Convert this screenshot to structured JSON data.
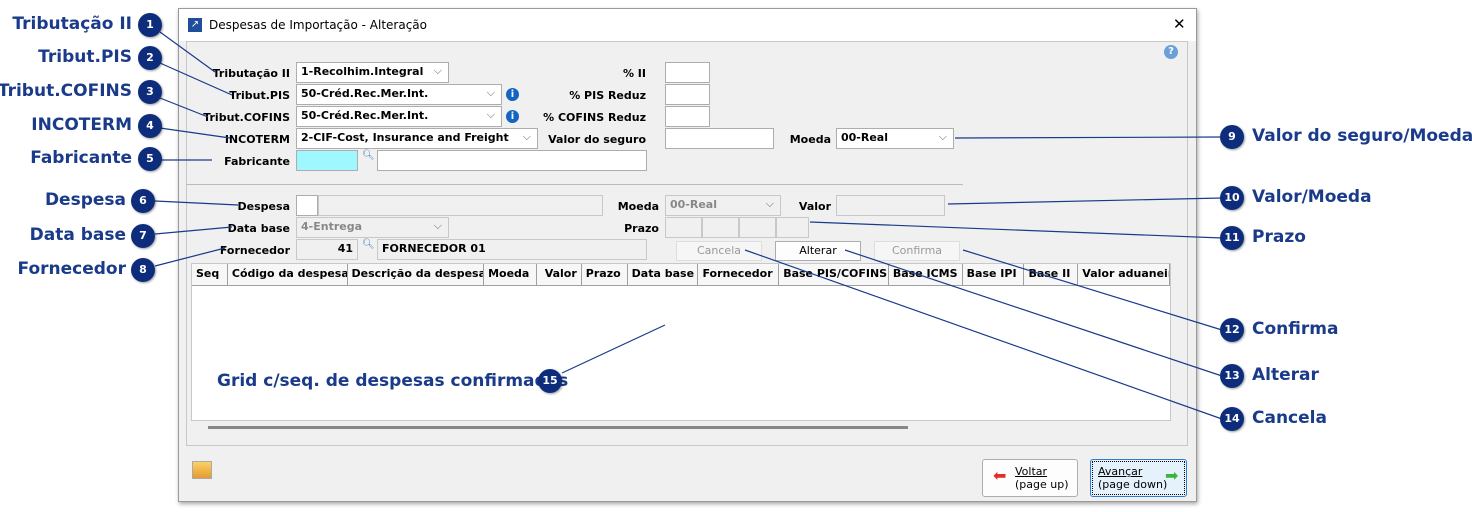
{
  "window": {
    "title": "Despesas de Importação - Alteração",
    "close": "✕",
    "help": "?"
  },
  "form": {
    "tributacao_ii": {
      "label": "Tributação II",
      "value": "1-Recolhim.Integral"
    },
    "tribut_pis": {
      "label": "Tribut.PIS",
      "value": "50-Créd.Rec.Mer.Int."
    },
    "tribut_cofins": {
      "label": "Tribut.COFINS",
      "value": "50-Créd.Rec.Mer.Int."
    },
    "incoterm": {
      "label": "INCOTERM",
      "value": "2-CIF-Cost, Insurance and Freight"
    },
    "fabricante": {
      "label": "Fabricante",
      "code": "",
      "name": ""
    },
    "pct_ii": {
      "label": "% II",
      "value": ""
    },
    "pct_pis": {
      "label": "% PIS Reduz",
      "value": ""
    },
    "pct_cofins": {
      "label": "% COFINS Reduz",
      "value": ""
    },
    "valor_seguro": {
      "label": "Valor do seguro",
      "value": ""
    },
    "moeda": {
      "label": "Moeda",
      "value": "00-Real"
    }
  },
  "despesa": {
    "despesa": {
      "label": "Despesa",
      "code": "",
      "desc": ""
    },
    "moeda": {
      "label": "Moeda",
      "value": "00-Real"
    },
    "valor": {
      "label": "Valor",
      "value": ""
    },
    "data_base": {
      "label": "Data base",
      "value": "4-Entrega"
    },
    "prazo": {
      "label": "Prazo"
    },
    "fornecedor": {
      "label": "Fornecedor",
      "code": "41",
      "name": "FORNECEDOR 01"
    },
    "cancela": "Cancela",
    "alterar": "Alterar",
    "confirma": "Confirma"
  },
  "grid": {
    "columns": [
      "Seq",
      "Código da despesa",
      "Descrição da despesa",
      "Moeda",
      "Valor",
      "Prazo",
      "Data base",
      "Fornecedor",
      "Base PIS/COFINS",
      "Base ICMS",
      "Base IPI",
      "Base II",
      "Valor aduaneiro"
    ]
  },
  "footer": {
    "voltar": "Voltar",
    "voltar_sub": "(page up)",
    "avancar": "Avançar",
    "avancar_sub": "(page down)"
  },
  "callouts": [
    {
      "n": "1",
      "text": "Tributação II"
    },
    {
      "n": "2",
      "text": "Tribut.PIS"
    },
    {
      "n": "3",
      "text": "Tribut.COFINS"
    },
    {
      "n": "4",
      "text": "INCOTERM"
    },
    {
      "n": "5",
      "text": "Fabricante"
    },
    {
      "n": "6",
      "text": "Despesa"
    },
    {
      "n": "7",
      "text": "Data base"
    },
    {
      "n": "8",
      "text": "Fornecedor"
    },
    {
      "n": "9",
      "text": "Valor do seguro/Moeda"
    },
    {
      "n": "10",
      "text": "Valor/Moeda"
    },
    {
      "n": "11",
      "text": "Prazo"
    },
    {
      "n": "12",
      "text": "Confirma"
    },
    {
      "n": "13",
      "text": "Alterar"
    },
    {
      "n": "14",
      "text": "Cancela"
    },
    {
      "n": "15",
      "text": "Grid c/seq. de despesas confirmadas"
    }
  ]
}
